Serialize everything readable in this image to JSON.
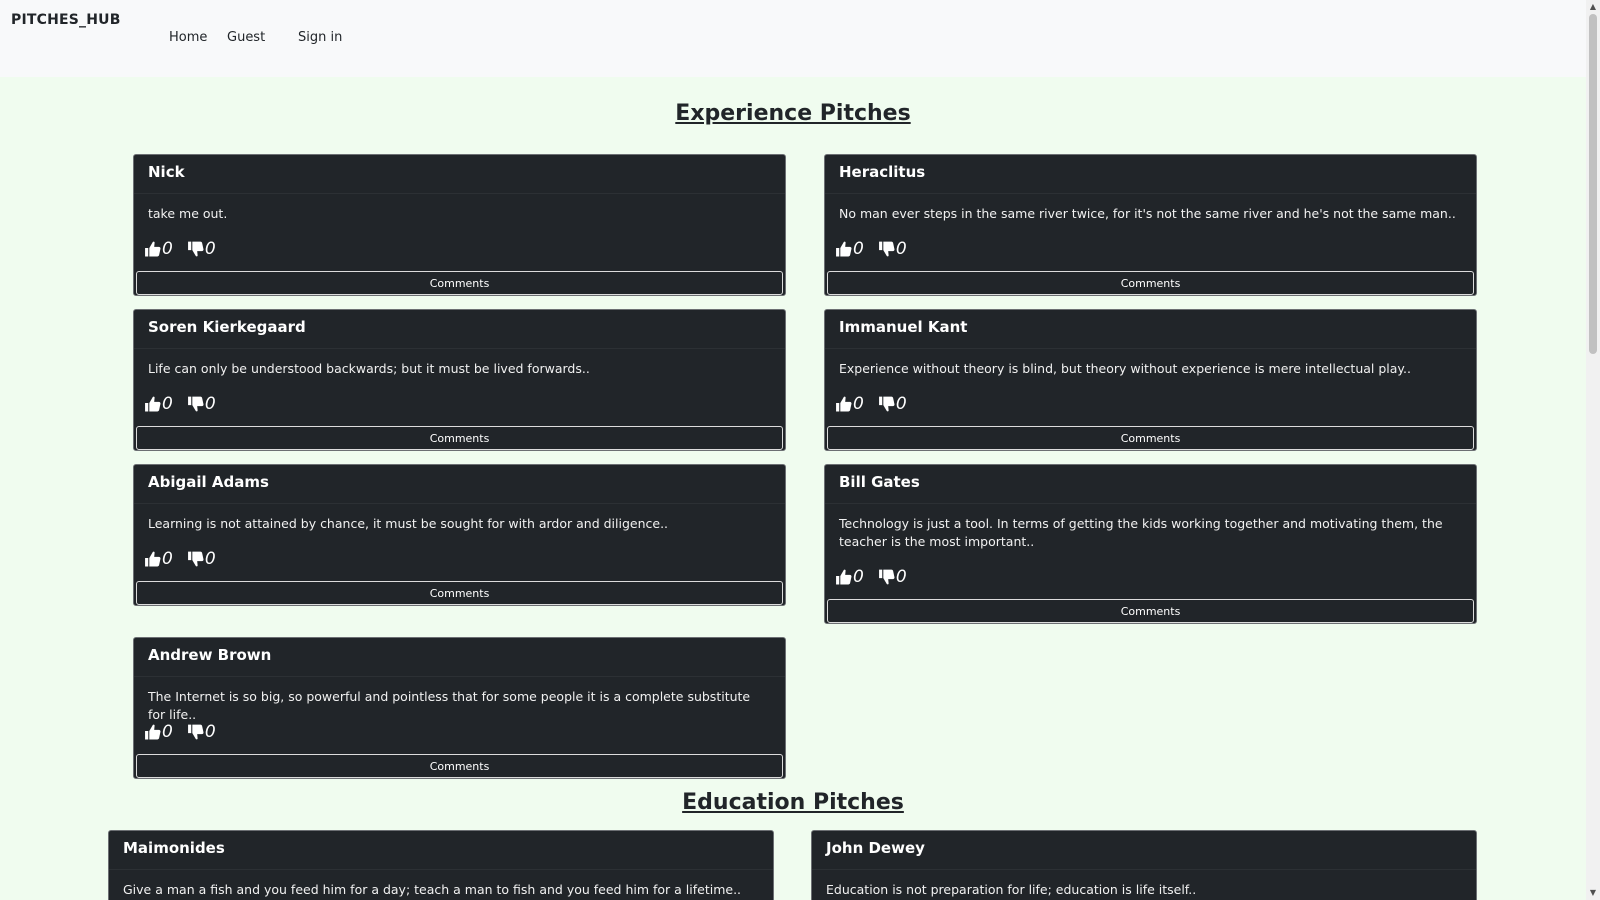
{
  "navbar": {
    "brand": "PITCHES_HUB",
    "links": [
      "Home",
      "Guest",
      "Sign in"
    ]
  },
  "sections": {
    "experience": {
      "title": "Experience Pitches",
      "pitches": [
        {
          "author": "Nick",
          "text": "take me out.",
          "upvotes": "0",
          "downvotes": "0",
          "comments_label": "Comments"
        },
        {
          "author": "Heraclitus",
          "text": "No man ever steps in the same river twice, for it's not the same river and he's not the same man..",
          "upvotes": "0",
          "downvotes": "0",
          "comments_label": "Comments"
        },
        {
          "author": "Soren Kierkegaard",
          "text": "Life can only be understood backwards; but it must be lived forwards..",
          "upvotes": "0",
          "downvotes": "0",
          "comments_label": "Comments"
        },
        {
          "author": "Immanuel Kant",
          "text": "Experience without theory is blind, but theory without experience is mere intellectual play..",
          "upvotes": "0",
          "downvotes": "0",
          "comments_label": "Comments"
        },
        {
          "author": "Abigail Adams",
          "text": "Learning is not attained by chance, it must be sought for with ardor and diligence..",
          "upvotes": "0",
          "downvotes": "0",
          "comments_label": "Comments"
        },
        {
          "author": "Bill Gates",
          "text": "Technology is just a tool. In terms of getting the kids working together and motivating them, the teacher is the most important..",
          "upvotes": "0",
          "downvotes": "0",
          "comments_label": "Comments"
        },
        {
          "author": "Andrew Brown",
          "text": "The Internet is so big, so powerful and pointless that for some people it is a complete substitute for life..",
          "upvotes": "0",
          "downvotes": "0",
          "comments_label": "Comments"
        }
      ]
    },
    "education": {
      "title": "Education Pitches",
      "pitches": [
        {
          "author": "Maimonides",
          "text": "Give a man a fish and you feed him for a day; teach a man to fish and you feed him for a lifetime.."
        },
        {
          "author": "John Dewey",
          "text": "Education is not preparation for life; education is life itself.."
        }
      ]
    }
  },
  "colors": {
    "page_background": "#f0fcef",
    "navbar_background": "#f8f9fa",
    "card_background": "#212529"
  }
}
